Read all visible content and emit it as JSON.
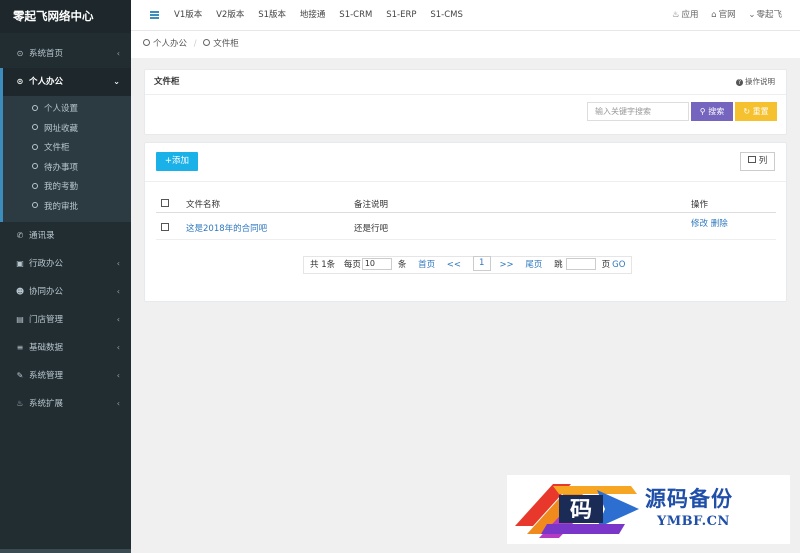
{
  "brand": "零起飞网络中心",
  "topbar": {
    "links": [
      "V1版本",
      "V2版本",
      "S1版本",
      "地接通",
      "S1-CRM",
      "S1-ERP",
      "S1-CMS"
    ],
    "right": {
      "app": "应用",
      "site": "官网",
      "user": "零起飞"
    }
  },
  "sidebar": {
    "home": "系统首页",
    "office": "个人办公",
    "office_items": [
      "个人设置",
      "网址收藏",
      "文件柜",
      "待办事项",
      "我的考勤",
      "我的审批"
    ],
    "rest": [
      "通讯录",
      "行政办公",
      "协同办公",
      "门店管理",
      "基础数据",
      "系统管理",
      "系统扩展"
    ]
  },
  "breadcrumb": {
    "first": "个人办公",
    "sep": "/",
    "second": "文件柜"
  },
  "panel": {
    "title": "文件柜",
    "help": "操作说明",
    "search_placeholder": "输入关键字搜索",
    "search_btn": "搜索",
    "reset_btn": "重置"
  },
  "list": {
    "add_btn": "添加",
    "col_btn": "列",
    "headers": {
      "name": "文件名称",
      "note": "备注说明",
      "ops": "操作"
    },
    "rows": [
      {
        "name": "这是2018年的合同吧",
        "note": "还是行吧",
        "edit": "修改",
        "del": "删除"
      }
    ]
  },
  "pager": {
    "total": "共 1条",
    "per_page_label": "每页",
    "per_page_value": "10",
    "per_page_unit": "条",
    "first": "首页",
    "prev": "<<",
    "current": "1",
    "next": ">>",
    "last": "尾页",
    "jump_label": "跳",
    "page_unit": "页",
    "go": "GO"
  },
  "watermark": {
    "text": "源码备份",
    "domain": "YMBF.CN",
    "glyph": "码"
  },
  "colors": {
    "sidebar": "#222d32",
    "accent": "#3c8dbc",
    "search": "#7565be",
    "reset": "#f6c12e",
    "add": "#1ab0e8",
    "link": "#2f78c0"
  }
}
